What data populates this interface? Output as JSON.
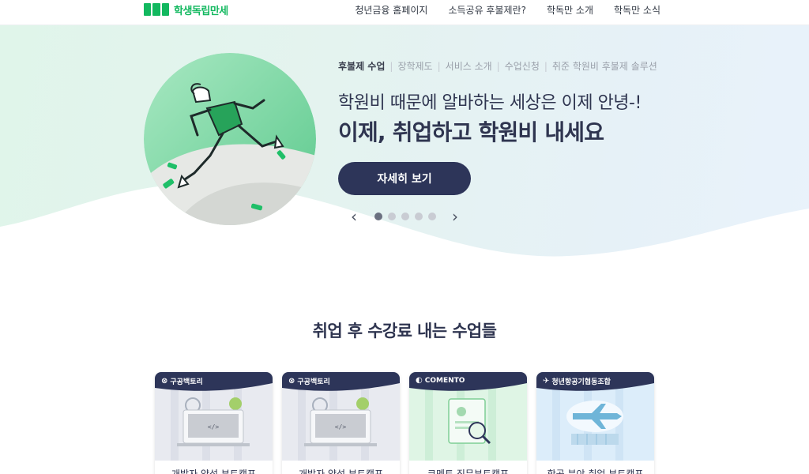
{
  "header": {
    "logo_text": "학생독립만세",
    "nav": [
      "청년금융 홈페이지",
      "소득공유 후불제란?",
      "학독만 소개",
      "학독만 소식"
    ]
  },
  "hero": {
    "subnav": [
      "후불제 수업",
      "장학제도",
      "서비스 소개",
      "수업신청",
      "취준 학원비 후불제 솔루션"
    ],
    "subtitle": "학원비 때문에 알바하는 세상은 이제 안녕-!",
    "title": "이제, 취업하고 학원비 내세요",
    "cta_label": "자세히 보기",
    "slides_total": 5,
    "slide_active": 1
  },
  "section": {
    "title": "취업 후 수강료 내는 수업들",
    "cards": [
      {
        "brand": "구공백토리",
        "title": "개발자 양성 부트캠프",
        "theme": "dev"
      },
      {
        "brand": "구공백토리",
        "title": "개발자 양성 부트캠프",
        "theme": "dev"
      },
      {
        "brand": "COMENTO",
        "title": "코멘토 직무부트캠프",
        "theme": "job"
      },
      {
        "brand": "청년항공기협동조합",
        "title": "항공 분야 취업 부트캠프",
        "theme": "air"
      }
    ]
  },
  "colors": {
    "brand_green": "#12b85f",
    "navy": "#2d3559",
    "hero_bg": "#e4f3ef"
  }
}
